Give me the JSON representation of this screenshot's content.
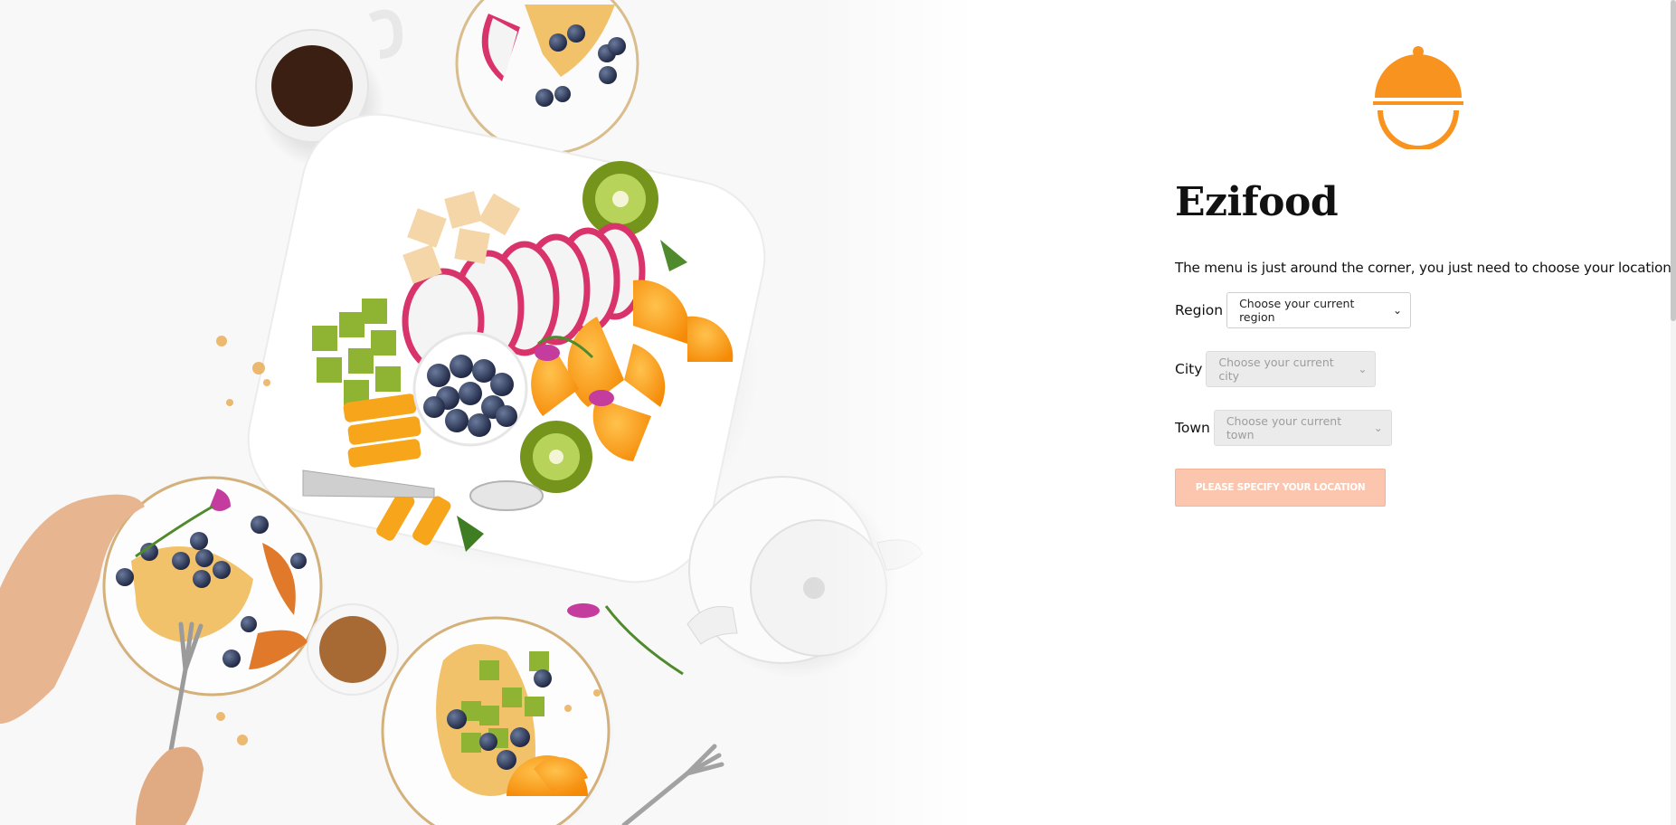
{
  "brand": {
    "name": "Ezifood",
    "logo_icon": "cloche-icon",
    "accent": "#f7931e"
  },
  "intro": "The menu is just around the corner, you just need to choose your location first.",
  "form": {
    "region": {
      "label": "Region",
      "value": "Choose your current region",
      "enabled": true
    },
    "city": {
      "label": "City",
      "value": "Choose your current city",
      "enabled": false
    },
    "town": {
      "label": "Town",
      "value": "Choose your current town",
      "enabled": false
    },
    "submit": {
      "label": "PLEASE SPECIFY YOUR LOCATION",
      "enabled": false,
      "color": "#fbc6ad"
    }
  },
  "hero": {
    "icon": "breakfast-table-photo"
  }
}
